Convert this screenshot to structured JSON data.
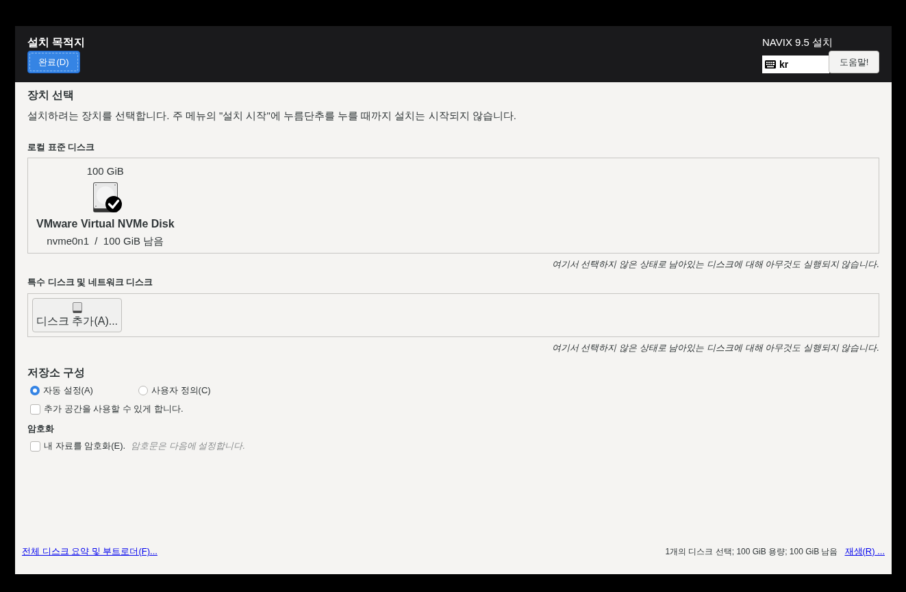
{
  "header": {
    "title": "설치 목적지",
    "done_button": "완료(D)",
    "product": "NAVIX 9.5 설치",
    "keyboard": "kr",
    "help_button": "도움말!"
  },
  "device_selection": {
    "heading": "장치 선택",
    "description": "설치하려는 장치를 선택합니다. 주 메뉴의 \"설치 시작\"에 누름단추를 누를 때까지 설치는 시작되지 않습니다."
  },
  "local_disks": {
    "heading": "로컬 표준 디스크",
    "disks": [
      {
        "size": "100 GiB",
        "name": "VMware Virtual NVMe Disk",
        "device": "nvme0n1  /  100 GiB 남음",
        "selected": true
      }
    ],
    "note": "여기서 선택하지 않은 상태로 남아있는 디스크에 대해 아무것도 실행되지 않습니다."
  },
  "special_disks": {
    "heading": "특수 디스크 및 네트워크 디스크",
    "add_button": "디스크 추가(A)...",
    "note": "여기서 선택하지 않은 상태로 남아있는 디스크에 대해 아무것도 실행되지 않습니다."
  },
  "storage_config": {
    "heading": "저장소 구성",
    "options": [
      {
        "label": "자동 설정(A)",
        "selected": true
      },
      {
        "label": "사용자 정의(C)",
        "selected": false
      }
    ],
    "extra_space": {
      "label": "추가 공간을 사용할 수 있게 합니다.",
      "checked": false
    }
  },
  "encryption": {
    "heading": "암호화",
    "checkbox": {
      "label": "내 자료를 암호화(E).",
      "checked": false
    },
    "hint": "암호문은 다음에 설정합니다."
  },
  "footer": {
    "summary_link": "전체 디스크 요약 및 부트로더(F)...",
    "status": "1개의 디스크 선택; 100 GiB 용량; 100 GiB 남음",
    "refresh_link": "재생(R) ..."
  }
}
